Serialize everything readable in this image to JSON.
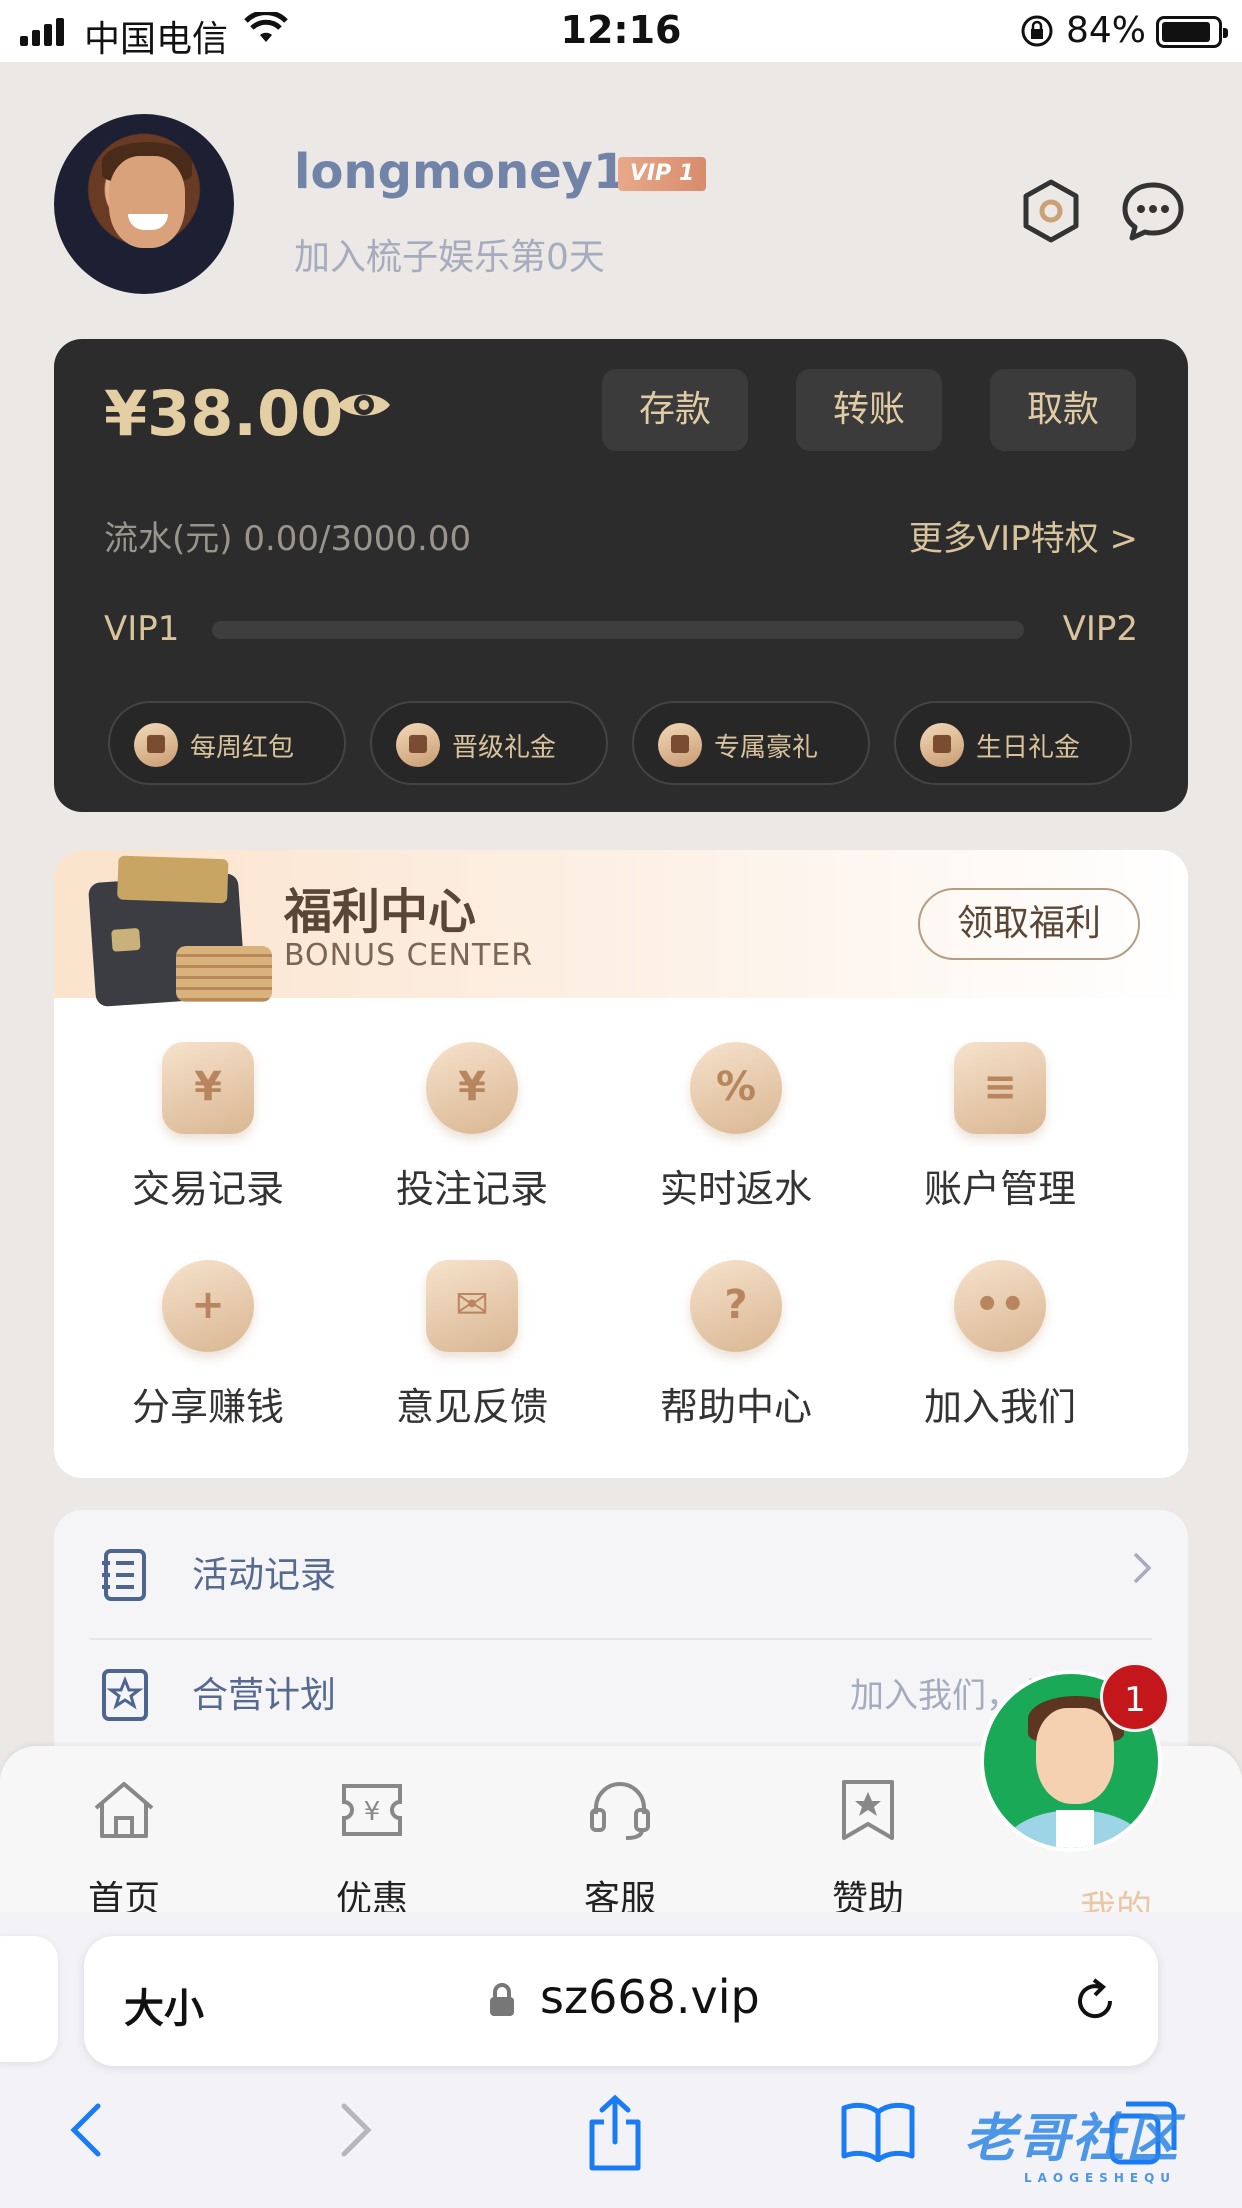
{
  "status_bar": {
    "carrier": "中国电信",
    "time": "12:16",
    "battery": "84%"
  },
  "profile": {
    "username": "longmoney1",
    "vip_badge": "VIP 1",
    "join_text": "加入梳子娱乐第0天"
  },
  "wallet": {
    "balance": "¥38.00",
    "buttons": [
      "存款",
      "转账",
      "取款"
    ],
    "flow_label": "流水(元) 0.00/3000.00",
    "more_vip": "更多VIP特权 >",
    "vip_current": "VIP1",
    "vip_next": "VIP2",
    "progress": 0.0,
    "perks": [
      "每周红包",
      "晋级礼金",
      "专属豪礼",
      "生日礼金"
    ]
  },
  "bonus_center": {
    "title": "福利中心",
    "subtitle": "BONUS CENTER",
    "claim_button": "领取福利",
    "items": [
      {
        "label": "交易记录",
        "icon": "calendar-yen-icon",
        "glyph": "¥"
      },
      {
        "label": "投注记录",
        "icon": "yen-coin-icon",
        "glyph": "¥"
      },
      {
        "label": "实时返水",
        "icon": "percent-badge-icon",
        "glyph": "%"
      },
      {
        "label": "账户管理",
        "icon": "id-card-icon",
        "glyph": "≡"
      },
      {
        "label": "分享赚钱",
        "icon": "add-user-icon",
        "glyph": "+"
      },
      {
        "label": "意见反馈",
        "icon": "envelope-icon",
        "glyph": "✉"
      },
      {
        "label": "帮助中心",
        "icon": "question-icon",
        "glyph": "?"
      },
      {
        "label": "加入我们",
        "icon": "people-icon",
        "glyph": "••"
      }
    ]
  },
  "list": {
    "rows": [
      {
        "label": "活动记录",
        "icon": "notebook-icon",
        "right": ""
      },
      {
        "label": "合营计划",
        "icon": "star-badge-icon",
        "right": "加入我们，共赢"
      }
    ]
  },
  "tabbar": {
    "tabs": [
      {
        "label": "首页",
        "icon": "home-icon"
      },
      {
        "label": "优惠",
        "icon": "ticket-yen-icon"
      },
      {
        "label": "客服",
        "icon": "headset-icon"
      },
      {
        "label": "赞助",
        "icon": "bookmark-star-icon"
      },
      {
        "label": "我的",
        "icon": "user-icon"
      }
    ],
    "notification_count": "1"
  },
  "browser": {
    "text_size_label": "大小",
    "url": "sz668.vip"
  },
  "watermark": {
    "text": "老哥社区",
    "sub": "LAOGESHEQU"
  },
  "colors": {
    "gold": "#d8c39c",
    "wallet_bg": "#2c2c2c",
    "accent_blue": "#7283a8",
    "ios_blue": "#1a7cf5",
    "badge_red": "#c4171c"
  }
}
